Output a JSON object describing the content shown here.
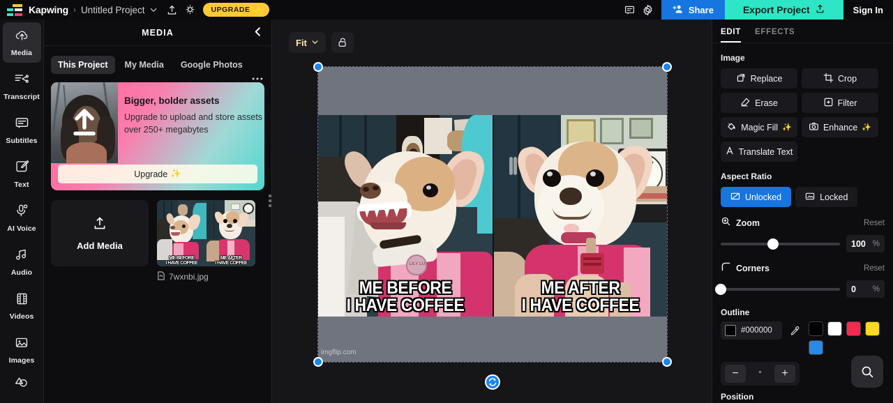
{
  "header": {
    "brand": "Kapwing",
    "breadcrumb_separator": "›",
    "project_name": "Untitled Project",
    "chevron_icon": "chevron-down-icon",
    "upload_icon": "upload-icon",
    "idea_icon": "lightbulb-icon",
    "upgrade_label": "UPGRADE",
    "upgrade_sparkle": "✨",
    "comment_icon": "comment-icon",
    "settings_icon": "gear-icon",
    "share_label": "Share",
    "share_icon": "add-person-icon",
    "export_label": "Export Project",
    "export_icon": "upload-icon",
    "signin_label": "Sign In",
    "share_color": "#1775e0",
    "export_color": "#2ee6c5",
    "upgrade_color": "#ffc933"
  },
  "sidebar": {
    "items": [
      {
        "label": "Media",
        "icon": "cloud-upload-icon",
        "active": true
      },
      {
        "label": "Transcript",
        "icon": "transcript-icon",
        "active": false
      },
      {
        "label": "Subtitles",
        "icon": "subtitles-icon",
        "active": false
      },
      {
        "label": "Text",
        "icon": "text-edit-icon",
        "active": false
      },
      {
        "label": "AI Voice",
        "icon": "microphone-icon",
        "active": false
      },
      {
        "label": "Audio",
        "icon": "music-note-icon",
        "active": false
      },
      {
        "label": "Videos",
        "icon": "film-strip-icon",
        "active": false
      },
      {
        "label": "Images",
        "icon": "image-icon",
        "active": false
      },
      {
        "label": "",
        "icon": "shapes-icon",
        "active": false
      }
    ]
  },
  "media_panel": {
    "title": "MEDIA",
    "collapse_icon": "chevron-left-icon",
    "more_icon": "more-horizontal-icon",
    "tabs": [
      {
        "label": "This Project",
        "active": true
      },
      {
        "label": "My Media",
        "active": false
      },
      {
        "label": "Google Photos",
        "active": false
      }
    ],
    "promo": {
      "title": "Bigger, bolder assets",
      "subtitle": "Upgrade to upload and store assets over 250+ megabytes",
      "cta_label": "Upgrade",
      "cta_sparkle": "✨",
      "overlay_icon": "upload-arrow-icon"
    },
    "add_media": {
      "label": "Add Media",
      "icon": "upload-icon"
    },
    "assets": [
      {
        "filename": "7wxnbi.jpg",
        "file_icon": "file-image-icon",
        "caption_left_line1": "ME BEFORE",
        "caption_left_line2": "I HAVE COFFEE",
        "caption_right_line1": "ME AFTER",
        "caption_right_line2": "I HAVE COFFEE"
      }
    ],
    "drag_handle_icon": "drag-grip-icon"
  },
  "canvas": {
    "zoom_mode": "Fit",
    "zoom_chevron_icon": "chevron-down-icon",
    "lock_icon": "unlock-icon",
    "rotate_icon": "rotate-icon",
    "watermark": "imgflip.com",
    "meme": {
      "left_caption_line1": "ME BEFORE",
      "left_caption_line2": "I HAVE COFFEE",
      "right_caption_line1": "ME AFTER",
      "right_caption_line2": "I HAVE COFFEE",
      "dog_tag_text": "LILY LU"
    },
    "selection_handle_color": "#1a86f0"
  },
  "right_panel": {
    "tabs": [
      {
        "label": "EDIT",
        "active": true
      },
      {
        "label": "EFFECTS",
        "active": false
      }
    ],
    "image_section_label": "Image",
    "tools": [
      {
        "label": "Replace",
        "icon": "replace-icon",
        "sparkle": ""
      },
      {
        "label": "Crop",
        "icon": "crop-icon",
        "sparkle": ""
      },
      {
        "label": "Erase",
        "icon": "eraser-icon",
        "sparkle": ""
      },
      {
        "label": "Filter",
        "icon": "filter-icon",
        "sparkle": ""
      },
      {
        "label": "Magic Fill",
        "icon": "paint-bucket-icon",
        "sparkle": "✨"
      },
      {
        "label": "Enhance",
        "icon": "camera-icon",
        "sparkle": "✨"
      },
      {
        "label": "Translate Text",
        "icon": "translate-icon",
        "sparkle": ""
      }
    ],
    "aspect_ratio": {
      "label": "Aspect Ratio",
      "options": [
        {
          "label": "Unlocked",
          "icon": "unlocked-ratio-icon",
          "active": true
        },
        {
          "label": "Locked",
          "icon": "locked-ratio-icon",
          "active": false
        }
      ]
    },
    "zoom_slider": {
      "label": "Zoom",
      "icon": "magnify-icon",
      "reset_label": "Reset",
      "value": "100",
      "unit": "%",
      "percent_position": 44
    },
    "corners_slider": {
      "label": "Corners",
      "icon": "rounded-corner-icon",
      "reset_label": "Reset",
      "value": "0",
      "unit": "%",
      "percent_position": 0
    },
    "outline": {
      "label": "Outline",
      "hex_value": "#000000",
      "eyedropper_icon": "eyedropper-icon",
      "swatches": [
        "#000000",
        "#ffffff",
        "#f72a4e",
        "#fada1b",
        "#2a8ae8"
      ],
      "angle_value": "°",
      "minus_label": "−",
      "plus_label": "+"
    },
    "search_icon": "search-icon",
    "position_label": "Position"
  }
}
